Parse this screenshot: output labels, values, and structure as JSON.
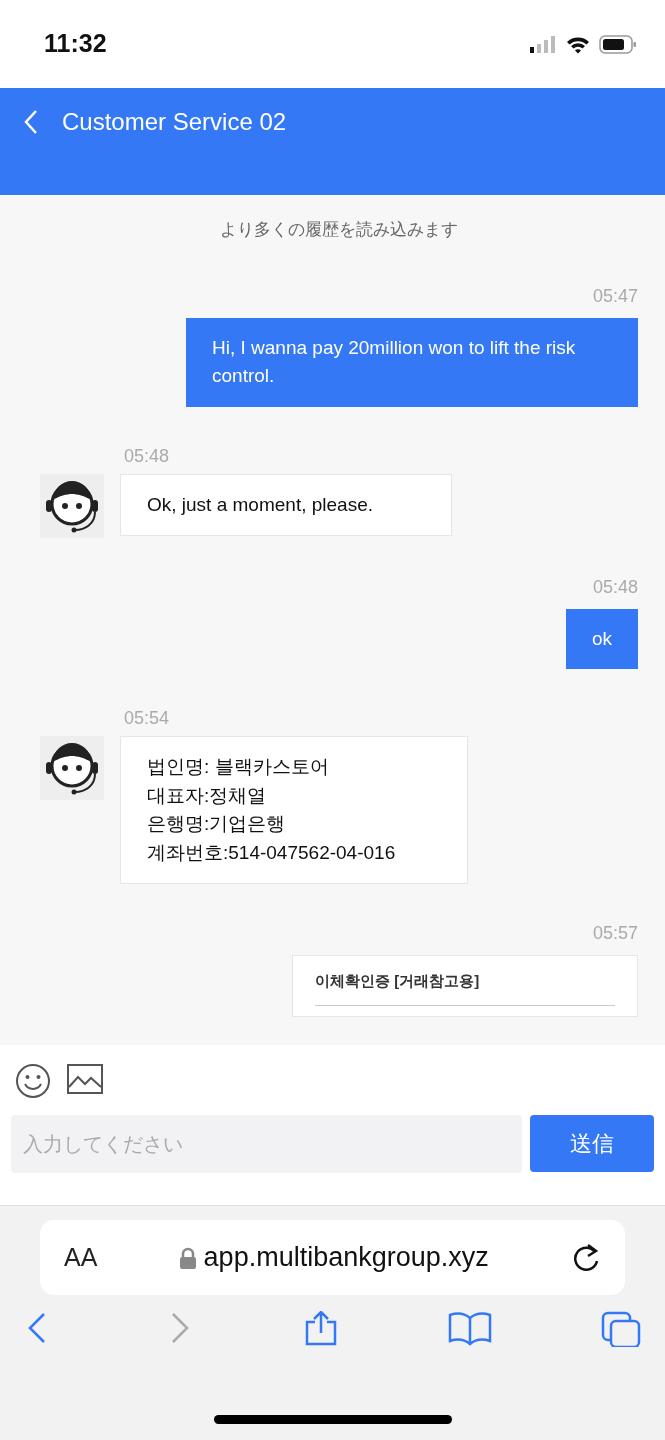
{
  "status_bar": {
    "time": "11:32"
  },
  "header": {
    "title": "Customer Service 02"
  },
  "load_more": "より多くの履歴を読み込みます",
  "messages": [
    {
      "kind": "sent",
      "time": "05:47",
      "text": "Hi, I wanna pay 20million won to lift the risk control."
    },
    {
      "kind": "received",
      "time": "05:48",
      "text": "Ok, just a moment, please."
    },
    {
      "kind": "sent",
      "time": "05:48",
      "text": "ok"
    },
    {
      "kind": "received",
      "time": "05:54",
      "lines": [
        "법인명: 블랙카스토어",
        "대표자:정채열",
        "은행명:기업은행",
        "계좌번호:514-047562-04-016"
      ]
    },
    {
      "kind": "document",
      "time": "05:57",
      "text": "이체확인증 [거래참고용]"
    }
  ],
  "composer": {
    "placeholder": "入力してください",
    "send": "送信"
  },
  "browser": {
    "text_size": "AA",
    "url": "app.multibankgroup.xyz",
    "toolbar": [
      {
        "kind": "back",
        "disabled": false
      },
      {
        "kind": "forward",
        "disabled": true
      },
      {
        "kind": "share",
        "disabled": false
      },
      {
        "kind": "bookmarks",
        "disabled": false
      },
      {
        "kind": "tabs",
        "disabled": false
      }
    ]
  }
}
